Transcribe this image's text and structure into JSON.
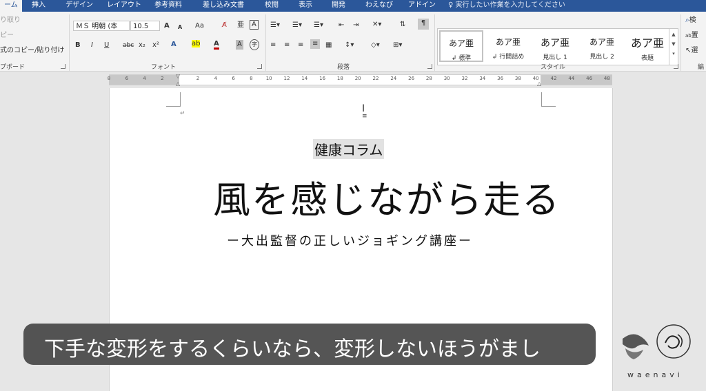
{
  "tabs": [
    "ーム",
    "挿入",
    "デザイン",
    "レイアウト",
    "参考資料",
    "差し込み文書",
    "校閲",
    "表示",
    "開発",
    "わえなび",
    "アドイン"
  ],
  "tell_me": "実行したい作業を入力してください",
  "clipboard": {
    "cut": "り取り",
    "copy": "ピー",
    "format_painter": "式のコピー/貼り付け",
    "label": "プボード"
  },
  "font": {
    "name": "ＭＳ 明朝 (本",
    "size": "10.5",
    "grow": "A",
    "shrink": "A",
    "case": "Aa",
    "bold": "B",
    "italic": "I",
    "underline": "U",
    "strike": "abc",
    "subscript": "x₂",
    "superscript": "x²",
    "label": "フォント",
    "accent_color": "#c00000"
  },
  "paragraph": {
    "label": "段落"
  },
  "styles": {
    "label": "スタイル",
    "items": [
      {
        "sample": "あア亜",
        "name": "↲ 標準"
      },
      {
        "sample": "あア亜",
        "name": "↲ 行間詰め"
      },
      {
        "sample": "あア亜",
        "name": "見出し 1"
      },
      {
        "sample": "あア亜",
        "name": "見出し 2"
      },
      {
        "sample": "あア亜",
        "name": "表題"
      }
    ]
  },
  "editing": {
    "find": "検",
    "replace": "置",
    "select": "選",
    "label": "編"
  },
  "ruler": [
    "8",
    "6",
    "4",
    "2",
    "2",
    "4",
    "6",
    "8",
    "10",
    "12",
    "14",
    "16",
    "18",
    "20",
    "22",
    "24",
    "26",
    "28",
    "30",
    "32",
    "34",
    "36",
    "38",
    "40",
    "42",
    "44",
    "46",
    "48"
  ],
  "document": {
    "title_small": "健康コラム",
    "title_big": "風を感じながら走る",
    "subtitle": "ー大出監督の正しいジョギング講座ー"
  },
  "caption": "下手な変形をするくらいなら、変形しないほうがまし",
  "logo_text": "waenavi",
  "colors": {
    "ribbon_blue": "#2b579a",
    "caption_bg": "#464646"
  }
}
